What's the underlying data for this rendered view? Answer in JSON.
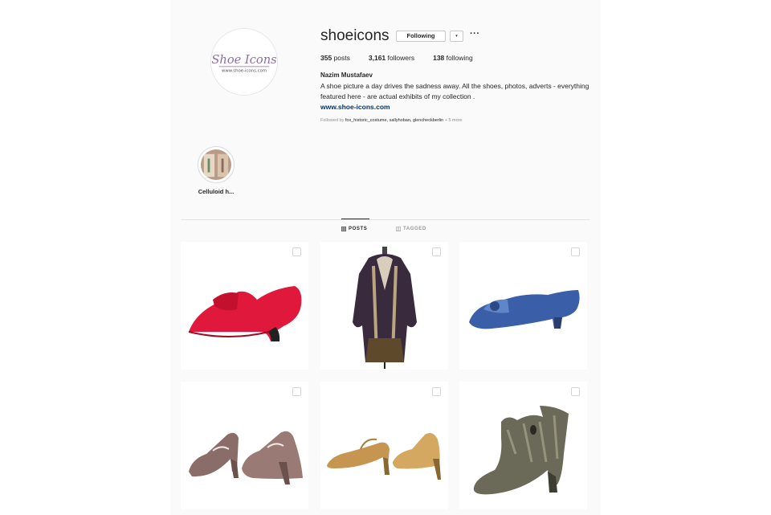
{
  "profile": {
    "username": "shoeicons",
    "follow_button": "Following",
    "dropdown_glyph": "▾",
    "more_glyph": "···",
    "stats": {
      "posts": "355",
      "posts_label": "posts",
      "followers": "3,161",
      "followers_label": "followers",
      "following": "138",
      "following_label": "following"
    },
    "full_name": "Nazim Mustafaev",
    "bio": "A shoe picture a day drives the sadness away. All the shoes, photos, adverts - everything featured here - are actual exhibits of my collection .",
    "website": "www.shoe-icons.com",
    "followed_by_prefix": "Followed by ",
    "followed_by_names": "fox_historic_costume, sallyhoban, glencheckberlin",
    "followed_by_more": " + 5 more",
    "avatar_logo_line1": "Shoe Icons",
    "avatar_logo_line2": "www.shoe-icons.com"
  },
  "highlights": [
    {
      "label": "Celluloid h..."
    }
  ],
  "tabs": {
    "posts": "POSTS",
    "tagged": "TAGGED"
  },
  "posts": [
    {
      "subject": "red silk shoe",
      "color": "#e0183c"
    },
    {
      "subject": "embroidered coat",
      "color": "#3a2a3e"
    },
    {
      "subject": "blue satin shoe",
      "color": "#3a5fa8"
    },
    {
      "subject": "mauve strap shoes",
      "color": "#8a6d68"
    },
    {
      "subject": "gold strap shoes",
      "color": "#c69650"
    },
    {
      "subject": "lace ankle boot",
      "color": "#6b6a58"
    }
  ]
}
